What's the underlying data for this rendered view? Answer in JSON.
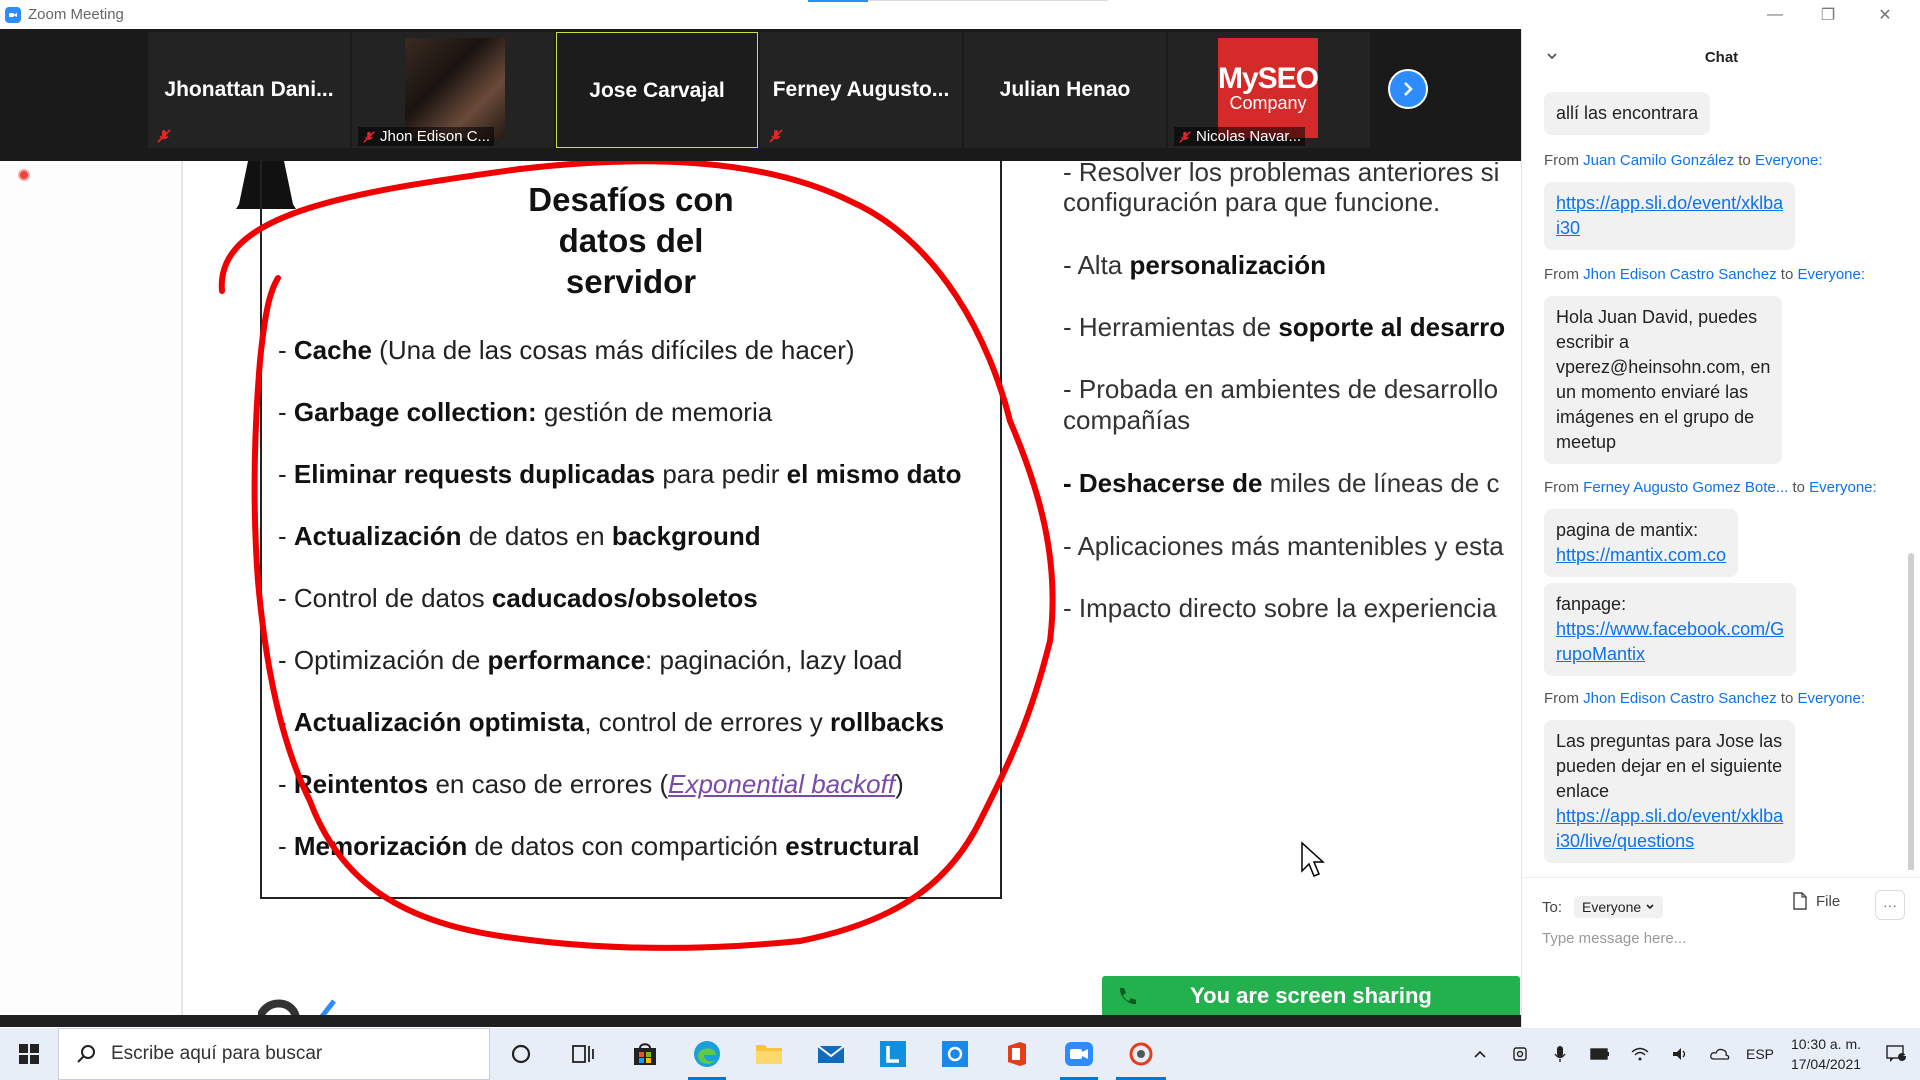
{
  "window": {
    "title": "Zoom Meeting",
    "controls": {
      "minimize": "—",
      "restore": "❐",
      "close": "✕"
    }
  },
  "participants": [
    {
      "name": "Jhonattan  Dani...",
      "muted": true,
      "type": "name"
    },
    {
      "name": "Jhon Edison C...",
      "muted": true,
      "type": "photo"
    },
    {
      "name": "Jose Carvajal",
      "muted": false,
      "type": "name",
      "active_speaker": true
    },
    {
      "name": "Ferney  Augusto...",
      "muted": true,
      "type": "name"
    },
    {
      "name": "Julian Henao",
      "muted": false,
      "type": "name"
    },
    {
      "name": "Nicolas Navar...",
      "muted": true,
      "type": "logo",
      "logo_top": "MySEO",
      "logo_bottom": "Company"
    }
  ],
  "slide": {
    "title_lines": [
      "Desafíos con",
      "datos del",
      "servidor"
    ],
    "items": [
      {
        "bold": "Cache",
        "rest": " (Una de las cosas más difíciles de hacer)"
      },
      {
        "bold": "Garbage collection:",
        "rest": " gestión de memoria"
      },
      {
        "bold": "Eliminar requests duplicadas",
        "rest": " para pedir ",
        "bold2": "el mismo dato"
      },
      {
        "bold": "Actualización",
        "rest": " de datos en ",
        "bold2": "background"
      },
      {
        "pre": "Control de datos ",
        "bold": "caducados/obsoletos"
      },
      {
        "pre": "Optimización de ",
        "bold": "performance",
        "rest": ": paginación, lazy load"
      },
      {
        "bold": "Actualización optimista",
        "rest": ", control de errores y ",
        "bold2": "rollbacks"
      },
      {
        "bold": "Reintentos",
        "rest": " en caso de errores (",
        "link": "Exponential backoff",
        "rest2": ")"
      },
      {
        "bold": "Memorización",
        "rest": " de datos con compartición ",
        "bold2": "estructural"
      }
    ],
    "right_items": [
      {
        "text_a": "- Resolver los problemas anteriores si",
        "text_b": "configuración para que funcione."
      },
      {
        "pre": "- Alta ",
        "bold": "personalización"
      },
      {
        "pre": "- Herramientas de ",
        "bold": "soporte al desarro"
      },
      {
        "text_a": "- Probada en ambientes de desarrollo",
        "text_b": "compañías"
      },
      {
        "bold": "- Deshacerse de",
        "rest": " miles de líneas de c"
      },
      {
        "pre": "- Aplicaciones más mantenibles y esta"
      },
      {
        "pre": "- Impacto directo sobre la experiencia"
      }
    ],
    "sharing_banner": "You are screen sharing"
  },
  "chat": {
    "title": "Chat",
    "messages": [
      {
        "text": "allí las encontrara"
      },
      {
        "from": "Juan Camilo González",
        "to": "Everyone:",
        "link": "https://app.sli.do/event/xklba",
        "link2": "i30"
      },
      {
        "from": "Jhon Edison Castro Sanchez",
        "to": "Everyone:",
        "lines": [
          "Hola Juan David, puedes",
          "escribir a",
          "vperez@heinsohn.com, en",
          "un momento enviaré las",
          "imágenes en el grupo de",
          "meetup"
        ]
      },
      {
        "from": "Ferney Augusto Gomez Bote...",
        "to": "Everyone:",
        "text": "pagina de mantix:",
        "link": "https://mantix.com.co"
      },
      {
        "text": "fanpage:",
        "link": "https://www.facebook.com/G",
        "link2": "rupoMantix"
      },
      {
        "from": "Jhon Edison Castro Sanchez",
        "to": "Everyone:",
        "lines": [
          "Las preguntas para Jose las",
          "pueden dejar en el siguiente",
          "enlace"
        ],
        "link": "https://app.sli.do/event/xklba",
        "link2": "i30/live/questions"
      }
    ],
    "from_label": "From",
    "to_label": "to",
    "footer": {
      "to_label": "To:",
      "to_value": "Everyone",
      "file_label": "File",
      "more": "···",
      "placeholder": "Type message here..."
    }
  },
  "taskbar": {
    "search_placeholder": "Escribe aquí para buscar",
    "lang": "ESP",
    "time": "10:30 a. m.",
    "date": "17/04/2021",
    "notifications": "1"
  }
}
